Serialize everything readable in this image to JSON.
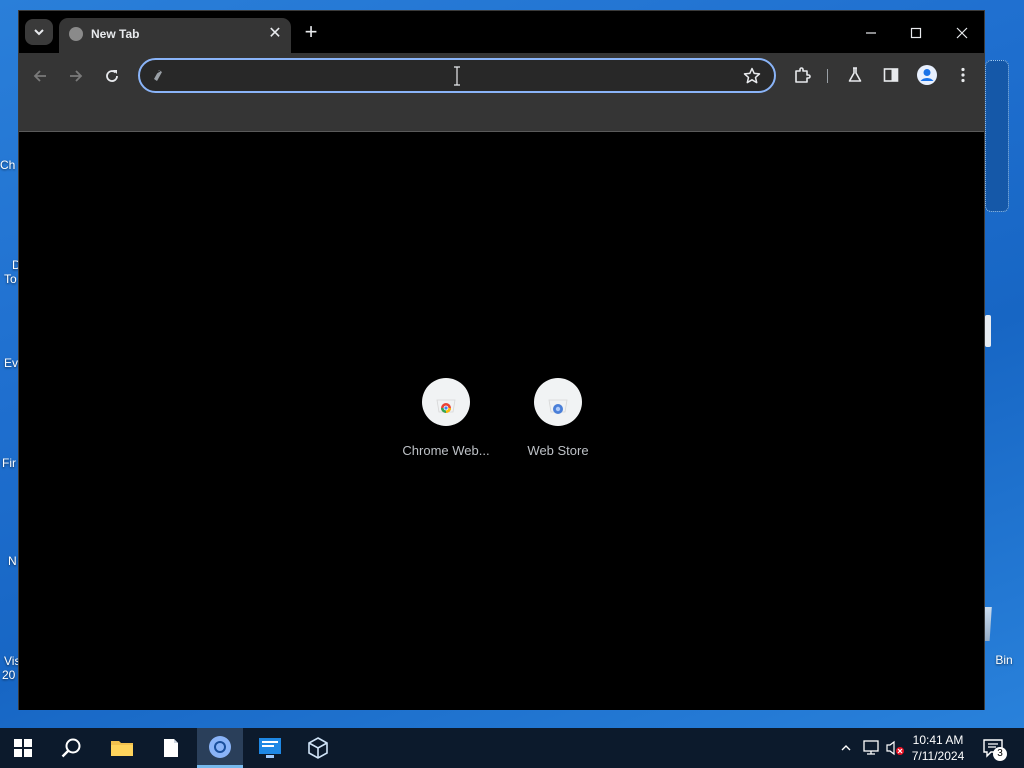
{
  "desktop": {
    "left_labels": [
      "Ch",
      "D",
      "To",
      "Ev",
      "Fir",
      "N",
      "Vis",
      "20"
    ],
    "recycle_label": "Bin"
  },
  "browser": {
    "tab": {
      "title": "New Tab",
      "close": "✕"
    },
    "new_tab": "+",
    "window_controls": {
      "minimize": "—",
      "maximize": "☐",
      "close": "✕"
    },
    "omnibox": {
      "value": "",
      "placeholder": ""
    },
    "shortcuts": [
      {
        "label": "Chrome Web..."
      },
      {
        "label": "Web Store"
      }
    ]
  },
  "taskbar": {
    "time": "10:41 AM",
    "date": "7/11/2024",
    "notification_count": "3"
  },
  "colors": {
    "accent": "#8ab4f8",
    "taskbar": "#0c1a2c",
    "toolbar": "#353535",
    "content": "#000000"
  }
}
